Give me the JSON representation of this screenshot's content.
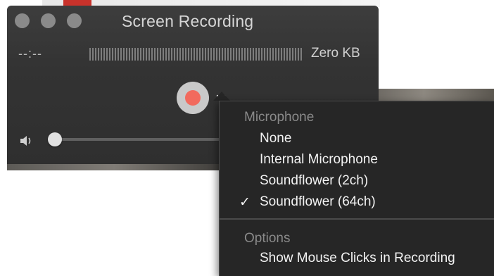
{
  "window": {
    "title": "Screen Recording",
    "elapsed_time": "--:--",
    "file_size": "Zero KB"
  },
  "volume": {
    "level": 0
  },
  "record_button": {
    "color": "#f26a5d"
  },
  "menu": {
    "microphone_header": "Microphone",
    "microphone_items": [
      {
        "label": "None",
        "checked": false
      },
      {
        "label": "Internal Microphone",
        "checked": false
      },
      {
        "label": "Soundflower (2ch)",
        "checked": false
      },
      {
        "label": "Soundflower (64ch)",
        "checked": true
      }
    ],
    "check_glyph": "✓",
    "options_header": "Options",
    "options_items": [
      {
        "label": "Show Mouse Clicks in Recording",
        "checked": false
      }
    ]
  },
  "icons": [
    "close-icon",
    "minimize-icon",
    "zoom-icon",
    "speaker-icon",
    "chevron-down-icon",
    "checkmark-icon"
  ]
}
